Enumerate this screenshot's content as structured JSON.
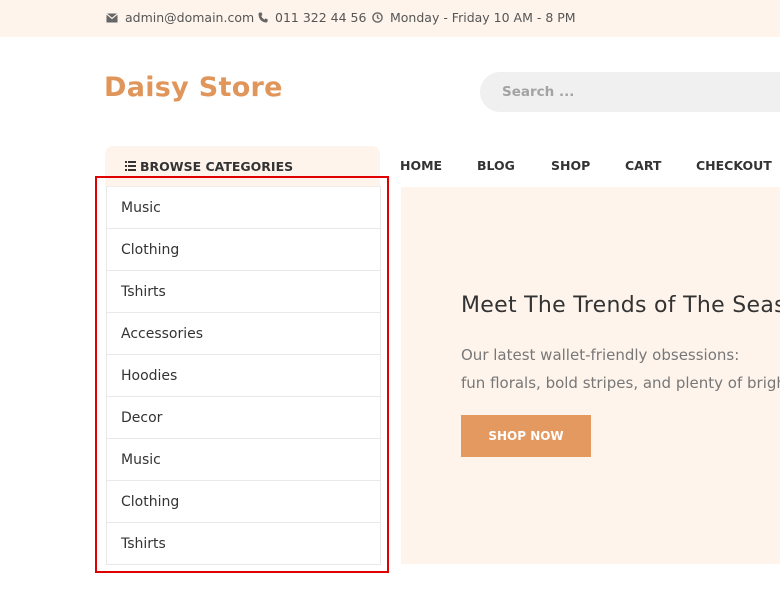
{
  "topbar": {
    "email": "admin@domain.com",
    "phone": "011 322 44 56",
    "hours": "Monday - Friday 10 AM - 8 PM",
    "icons": [
      "envelope-icon",
      "phone-icon",
      "clock-icon"
    ]
  },
  "header": {
    "logo": "Daisy Store",
    "search_placeholder": "Search ..."
  },
  "categories": {
    "heading": "BROWSE CATEGORIES",
    "items": [
      "Music",
      "Clothing",
      "Tshirts",
      "Accessories",
      "Hoodies",
      "Decor",
      "Music",
      "Clothing",
      "Tshirts"
    ]
  },
  "nav": {
    "items": [
      "HOME",
      "BLOG",
      "SHOP",
      "CART",
      "CHECKOUT"
    ]
  },
  "hero": {
    "title": "Meet The Trends of The Season",
    "line1": "Our latest wallet-friendly obsessions:",
    "line2": "fun florals, bold stripes, and plenty of bright colors",
    "button": "SHOP NOW"
  },
  "colors": {
    "accent": "#e0955a",
    "button": "#e3995f",
    "light_bg": "#fef4ec",
    "highlight": "#e00000"
  }
}
